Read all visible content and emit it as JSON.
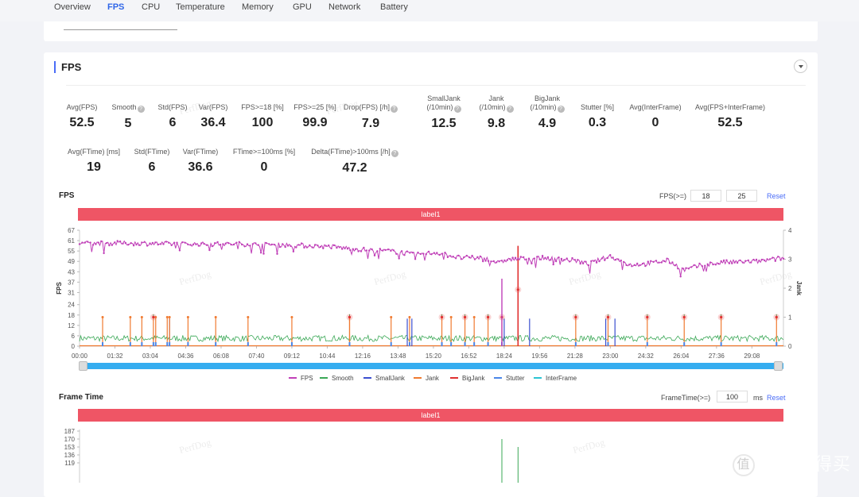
{
  "tabs": [
    {
      "label": "Overview",
      "active": false
    },
    {
      "label": "FPS",
      "active": true
    },
    {
      "label": "CPU",
      "active": false
    },
    {
      "label": "Temperature",
      "active": false
    },
    {
      "label": "Memory",
      "active": false
    },
    {
      "label": "GPU",
      "active": false
    },
    {
      "label": "Network",
      "active": false
    },
    {
      "label": "Battery",
      "active": false
    }
  ],
  "card": {
    "title": "FPS",
    "collapse_icon": "caret-down-icon"
  },
  "stats_row1": [
    {
      "label": "Avg(FPS)",
      "value": "52.5",
      "help": false
    },
    {
      "label": "Smooth",
      "value": "5",
      "help": true
    },
    {
      "label": "Std(FPS)",
      "value": "6",
      "help": false
    },
    {
      "label": "Var(FPS)",
      "value": "36.4",
      "help": false
    },
    {
      "label": "FPS>=18 [%]",
      "value": "100",
      "help": false
    },
    {
      "label": "FPS>=25 [%]",
      "value": "99.9",
      "help": false
    },
    {
      "label": "Drop(FPS) [/h]",
      "value": "7.9",
      "help": true
    },
    {
      "label": "SmallJank",
      "label2": "(/10min)",
      "value": "12.5",
      "help": true
    },
    {
      "label": "Jank",
      "label2": "(/10min)",
      "value": "9.8",
      "help": true
    },
    {
      "label": "BigJank",
      "label2": "(/10min)",
      "value": "4.9",
      "help": true
    },
    {
      "label": "Stutter [%]",
      "value": "0.3",
      "help": false
    },
    {
      "label": "Avg(InterFrame)",
      "value": "0",
      "help": false
    },
    {
      "label": "Avg(FPS+InterFrame)",
      "value": "52.5",
      "help": false
    }
  ],
  "stats_row2": [
    {
      "label": "Avg(FTime) [ms]",
      "value": "19",
      "help": false
    },
    {
      "label": "Std(FTime)",
      "value": "6",
      "help": false
    },
    {
      "label": "Var(FTime)",
      "value": "36.6",
      "help": false
    },
    {
      "label": "FTime>=100ms [%]",
      "value": "0",
      "help": false
    },
    {
      "label": "Delta(FTime)>100ms [/h]",
      "value": "47.2",
      "help": true
    }
  ],
  "help_glyph": "?",
  "fps_section": {
    "title": "FPS",
    "threshold_label": "FPS(>=)",
    "threshold1": "18",
    "threshold2": "25",
    "reset": "Reset",
    "label_bar": "label1"
  },
  "frametime_section": {
    "title": "Frame Time",
    "threshold_label": "FrameTime(>=)",
    "threshold": "100",
    "unit": "ms",
    "reset": "Reset",
    "label_bar": "label1"
  },
  "watermark": "PerfDog",
  "site_logo": {
    "circle": "值",
    "text": "什么值得买"
  },
  "chart_data": [
    {
      "type": "line",
      "title": "FPS",
      "xlabel": "",
      "ylabel": "FPS",
      "y2label": "Jank",
      "x_ticks": [
        "00:00",
        "01:32",
        "03:04",
        "04:36",
        "06:08",
        "07:40",
        "09:12",
        "10:44",
        "12:16",
        "13:48",
        "15:20",
        "16:52",
        "18:24",
        "19:56",
        "21:28",
        "23:00",
        "24:32",
        "26:04",
        "27:36",
        "29:08"
      ],
      "y_ticks": [
        0,
        6,
        12,
        18,
        24,
        31,
        37,
        43,
        49,
        55,
        61,
        67
      ],
      "y2_ticks": [
        0,
        1,
        2,
        3,
        4
      ],
      "ylim": [
        0,
        67
      ],
      "y2lim": [
        0,
        4
      ],
      "duration_min": 30.5,
      "legend": [
        "FPS",
        "Smooth",
        "SmallJank",
        "Jank",
        "BigJank",
        "Stutter",
        "InterFrame"
      ],
      "legend_position": "bottom",
      "colors": {
        "FPS": "#c040b8",
        "Smooth": "#3aa856",
        "SmallJank": "#3b4fd0",
        "Jank": "#f07a30",
        "BigJank": "#e03030",
        "Stutter": "#4a86e8",
        "InterFrame": "#2bc4d4"
      },
      "fps_trend": [
        [
          0,
          59.5
        ],
        [
          2,
          59.5
        ],
        [
          5,
          59
        ],
        [
          7,
          59
        ],
        [
          9,
          58.5
        ],
        [
          11,
          57.5
        ],
        [
          12.5,
          55.5
        ],
        [
          13.5,
          55
        ],
        [
          14.5,
          53
        ],
        [
          15.5,
          54
        ],
        [
          16.5,
          51
        ],
        [
          17.5,
          51
        ],
        [
          18.2,
          48
        ],
        [
          18.5,
          50
        ],
        [
          20,
          51
        ],
        [
          21.5,
          49.5
        ],
        [
          22,
          47.5
        ],
        [
          23,
          52
        ],
        [
          23.8,
          47
        ],
        [
          24.5,
          47.5
        ],
        [
          25.5,
          49.5
        ],
        [
          26.2,
          44
        ],
        [
          27,
          47
        ],
        [
          28,
          48.5
        ],
        [
          29.5,
          49
        ],
        [
          30.5,
          51
        ]
      ],
      "fps_drops": [
        [
          18.3,
          39
        ],
        [
          19.0,
          45
        ]
      ],
      "smooth_mean": 4.5,
      "jank_events_min": [
        1.0,
        2.2,
        2.7,
        3.3,
        3.8,
        3.9,
        4.7,
        5.9,
        7.3,
        9.2,
        11.7,
        13.5,
        14.3,
        16.1,
        17.1
      ],
      "bigjank_events_min": [
        3.2,
        11.7,
        15.7,
        16.7,
        17.7,
        18.3,
        21.5,
        22.9,
        24.6,
        26.2,
        27.8,
        30.2
      ],
      "smalljank_events_min": [
        3.9,
        14.2,
        14.4,
        18.4,
        19.5,
        22.8,
        23.2
      ],
      "big_spike": {
        "time_min": 19.0,
        "fps": 58.0,
        "jank": 1.95
      }
    },
    {
      "type": "line",
      "title": "Frame Time",
      "ylabel": "",
      "y_ticks_visible": [
        119,
        136,
        153,
        170,
        187
      ],
      "ylim_top": 187,
      "spikes": [
        {
          "time_min": 18.3,
          "value": 170
        },
        {
          "time_min": 19.0,
          "value": 153
        }
      ]
    }
  ]
}
